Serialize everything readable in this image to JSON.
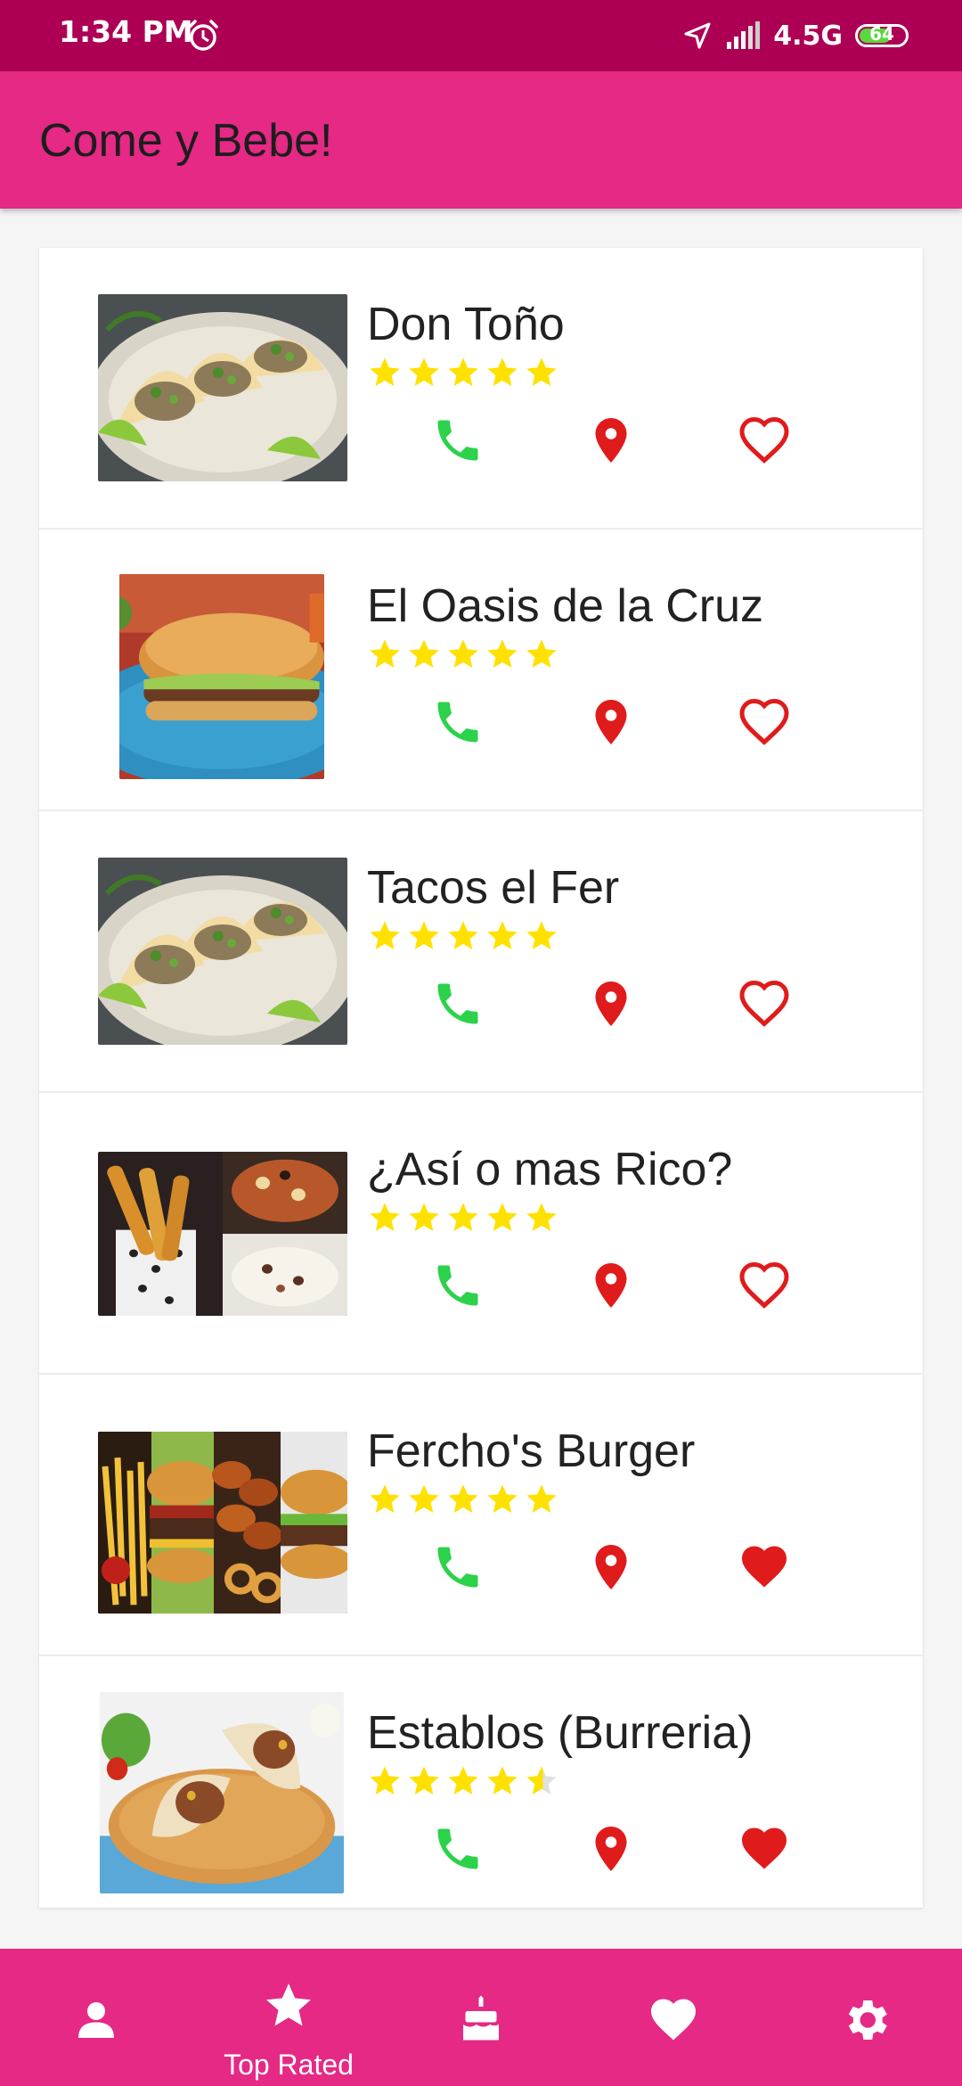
{
  "status_bar": {
    "time": "1:34 PM",
    "network": "4.5G",
    "battery_level": "64",
    "battery_percent": 64
  },
  "app": {
    "title": "Come y Bebe!",
    "accent_color": "#e52985",
    "status_bar_color": "#ad0054"
  },
  "restaurants": [
    {
      "name": "Don Toño",
      "rating": 5,
      "favorite": false,
      "thumbnail": "tacos-plate"
    },
    {
      "name": "El Oasis de la Cruz",
      "rating": 5,
      "favorite": false,
      "thumbnail": "torta-sandwich"
    },
    {
      "name": "Tacos el Fer",
      "rating": 5,
      "favorite": false,
      "thumbnail": "tacos-plate"
    },
    {
      "name": "¿Así o mas Rico?",
      "rating": 5,
      "favorite": false,
      "thumbnail": "churros-collage"
    },
    {
      "name": "Fercho's Burger",
      "rating": 5,
      "favorite": true,
      "thumbnail": "burger-collage"
    },
    {
      "name": "Establos (Burreria)",
      "rating": 4.5,
      "favorite": true,
      "thumbnail": "burrito-plate"
    }
  ],
  "icons": {
    "call": "phone-icon",
    "location": "location-pin-icon",
    "favorite": "heart-icon"
  },
  "colors": {
    "phone": "#2bd24a",
    "pin": "#e01b1b",
    "heart": "#e01b1b",
    "star": "#ffe100"
  },
  "bottom_nav": {
    "items": [
      {
        "icon": "person-icon",
        "label": ""
      },
      {
        "icon": "star-icon",
        "label": "Top Rated"
      },
      {
        "icon": "cake-icon",
        "label": ""
      },
      {
        "icon": "heart-icon",
        "label": ""
      },
      {
        "icon": "gear-icon",
        "label": ""
      }
    ],
    "active_index": 1
  }
}
